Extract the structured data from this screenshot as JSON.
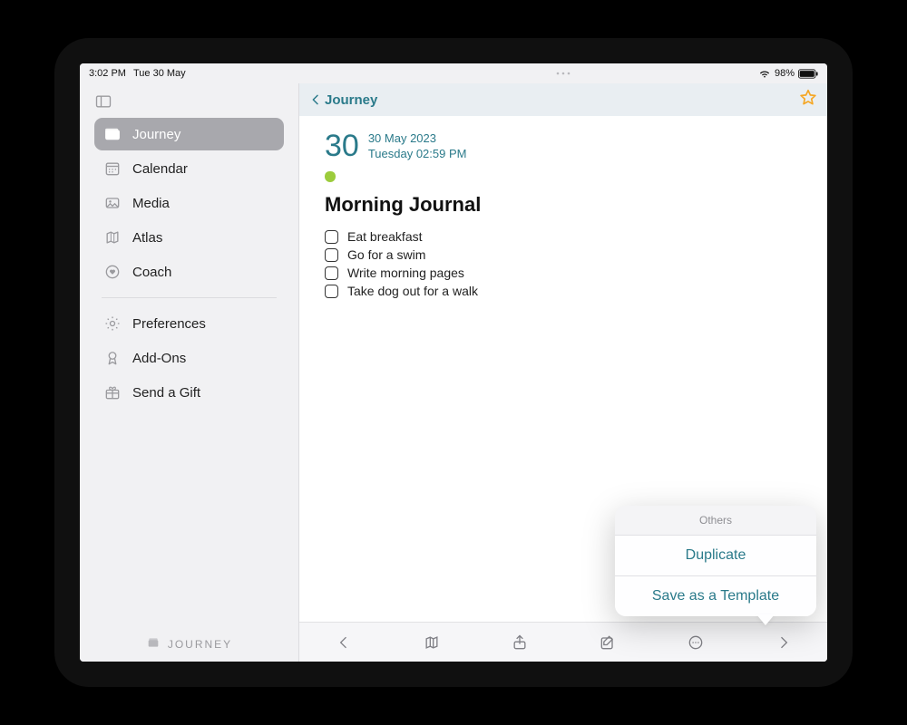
{
  "status_bar": {
    "time": "3:02 PM",
    "date": "Tue 30 May",
    "battery_pct": "98%"
  },
  "sidebar": {
    "items": [
      {
        "label": "Journey",
        "icon": "wallet-icon",
        "active": true
      },
      {
        "label": "Calendar",
        "icon": "calendar-icon",
        "active": false
      },
      {
        "label": "Media",
        "icon": "image-icon",
        "active": false
      },
      {
        "label": "Atlas",
        "icon": "map-icon",
        "active": false
      },
      {
        "label": "Coach",
        "icon": "heart-circle-icon",
        "active": false
      }
    ],
    "secondary": [
      {
        "label": "Preferences",
        "icon": "gear-icon"
      },
      {
        "label": "Add-Ons",
        "icon": "ribbon-icon"
      },
      {
        "label": "Send a Gift",
        "icon": "gift-icon"
      }
    ],
    "footer_brand": "JOURNEY"
  },
  "topbar": {
    "breadcrumb_label": "Journey"
  },
  "entry": {
    "day_number": "30",
    "date_line1": "30 May 2023",
    "date_line2": "Tuesday 02:59 PM",
    "title": "Morning Journal",
    "checklist": [
      "Eat breakfast",
      "Go for a swim",
      "Write morning pages",
      "Take dog out for a walk"
    ]
  },
  "popover": {
    "header": "Others",
    "items": [
      "Duplicate",
      "Save as a Template"
    ]
  }
}
